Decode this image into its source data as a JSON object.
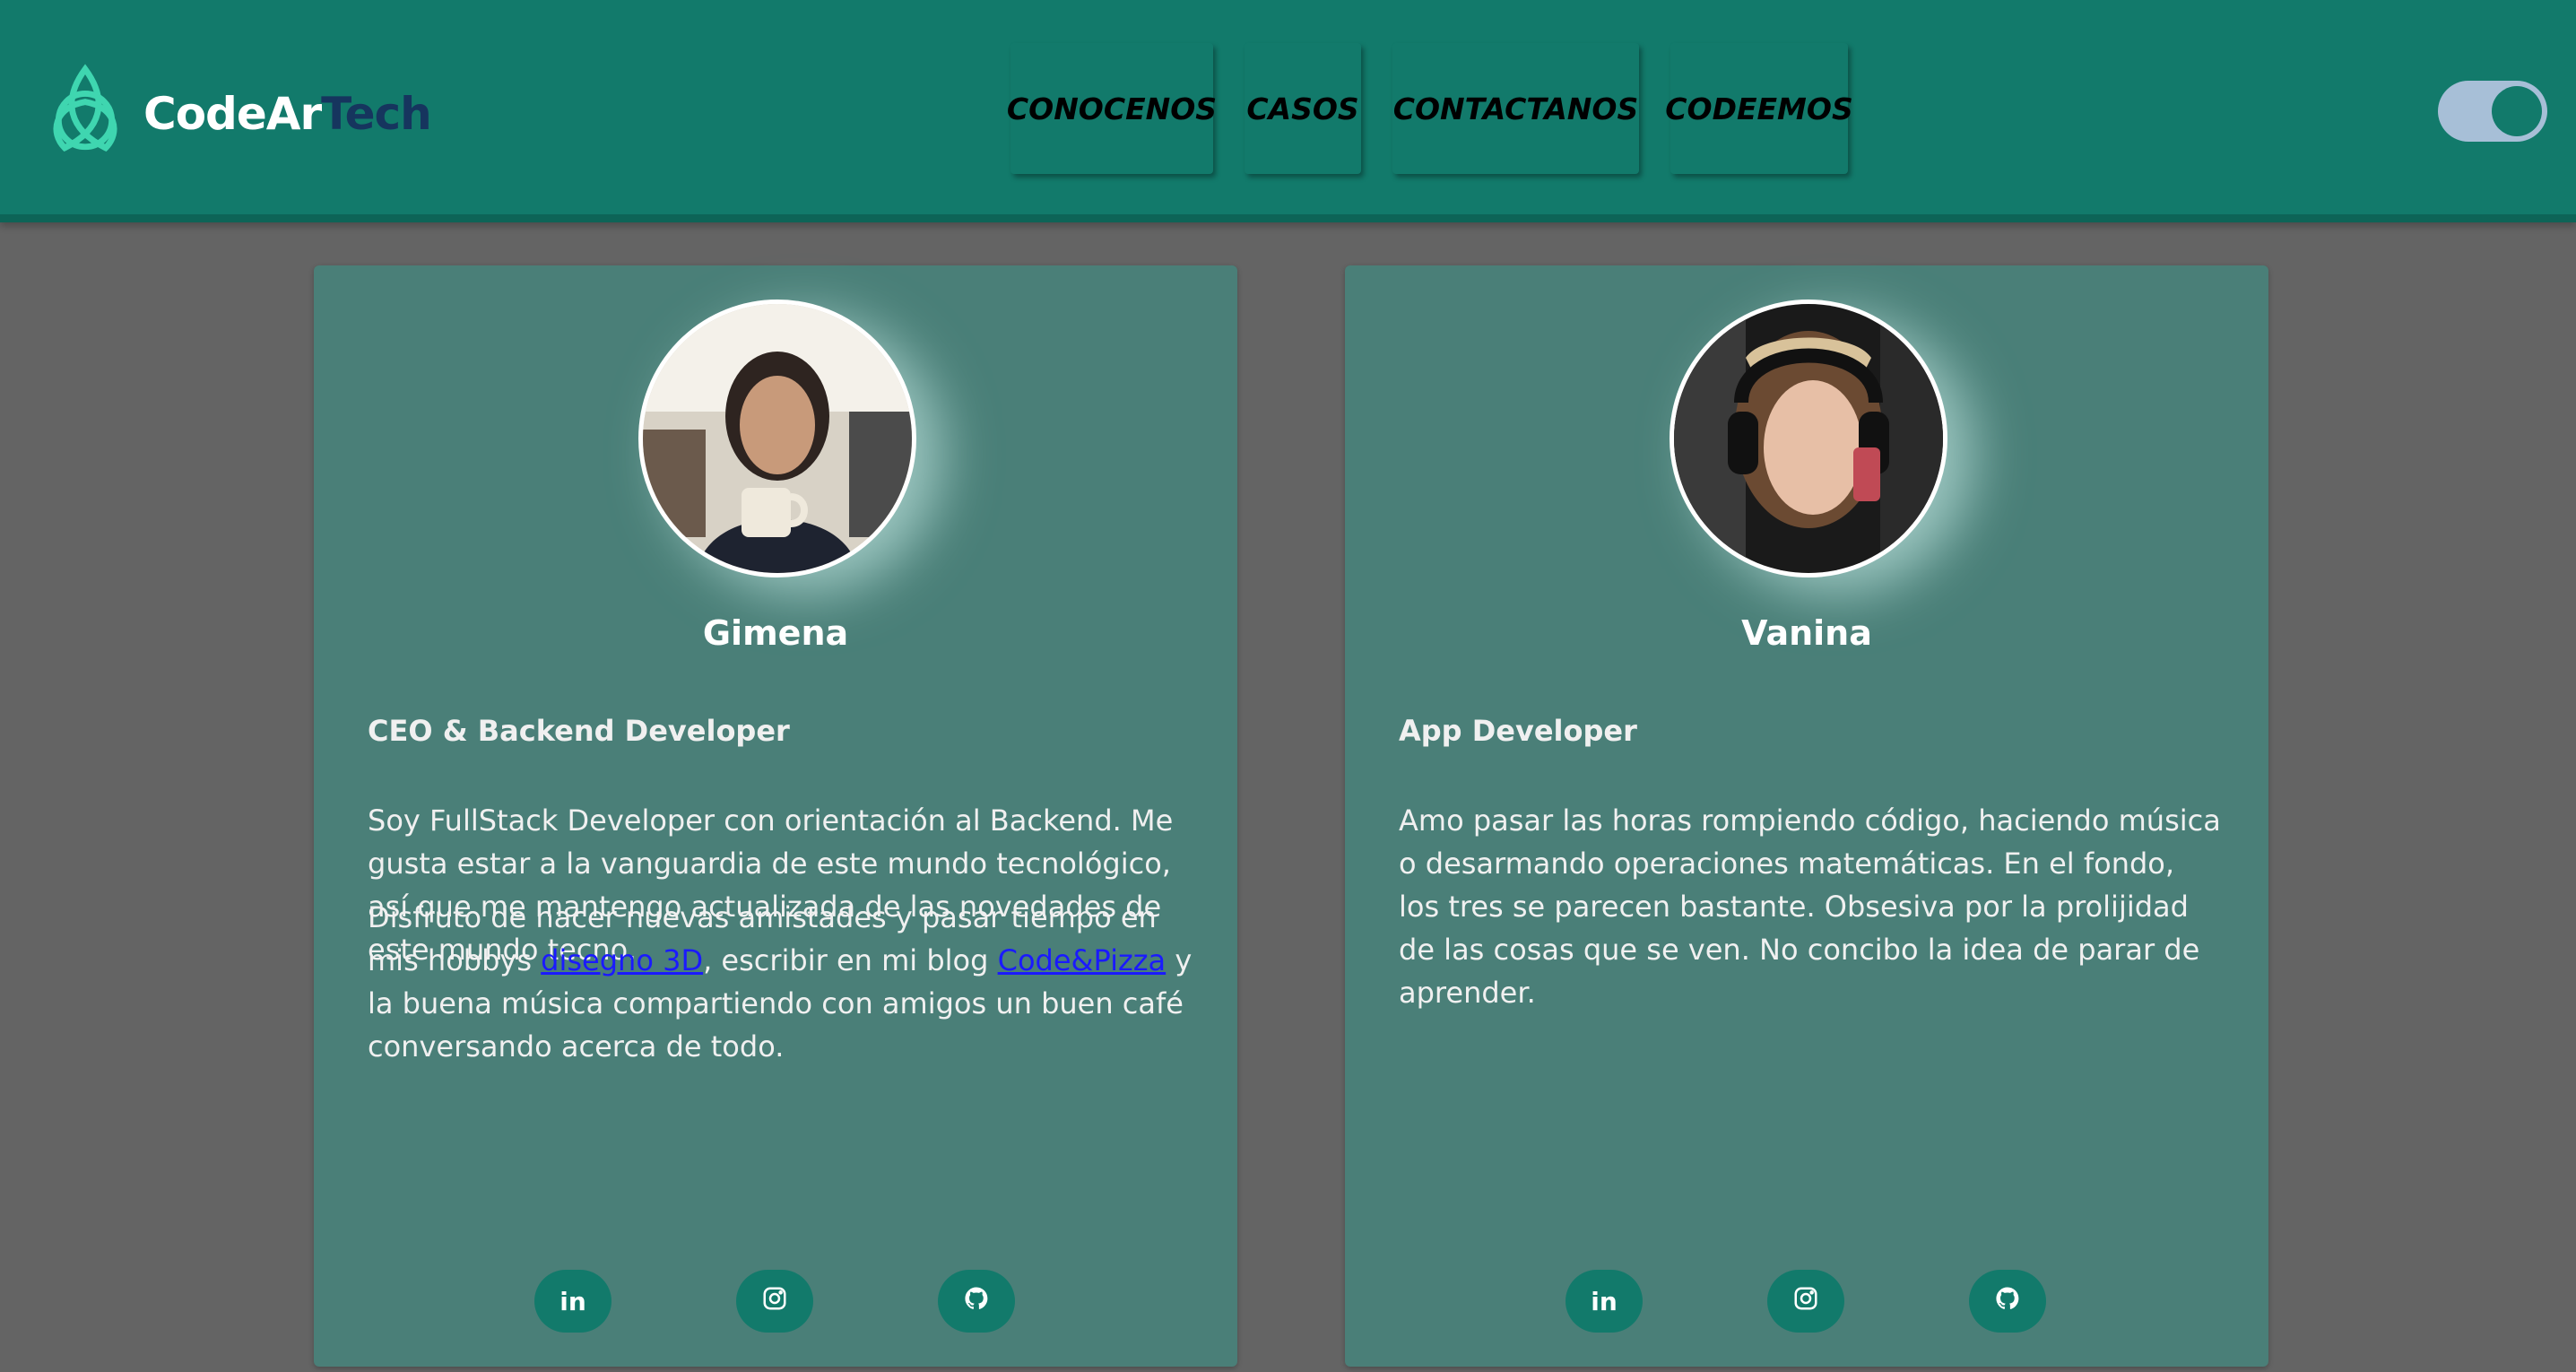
{
  "header": {
    "brand_part1": "CodeAr",
    "brand_part2": "Tech",
    "logo_icon": "triquetra-logo-icon",
    "nav": [
      "CONOCENOS",
      "CASOS",
      "CONTACTANOS",
      "CODEEMOS"
    ],
    "theme_toggle": {
      "state": "on"
    }
  },
  "colors": {
    "background": "#646464",
    "header": "#127a6b",
    "card": "#4a7f78",
    "brand_accent": "#16355e",
    "logo": "#3fd6b0",
    "link": "#1a1aff"
  },
  "cards": [
    {
      "name": "Gimena",
      "role": "CEO & Backend Developer",
      "bio1": "Soy FullStack Developer con orientación al Backend. Me gusta estar a la vanguardia de este mundo tecnológico, así que me mantengo actualizada de las novedades de este mundo tecno.",
      "bio2_part1": "Disfruto de hacer nuevas amistades y pasar tiempo en mis hobbys ",
      "bio2_link1": "disegno 3D",
      "bio2_part2": ", escribir en mi blog ",
      "bio2_link2": "Code&Pizza",
      "bio2_part3": " y la buena música compartiendo con amigos un buen café conversando acerca de todo.",
      "social": {
        "linkedin": "in",
        "instagram": "instagram-icon",
        "github": "github-icon"
      }
    },
    {
      "name": "Vanina",
      "role": "App Developer",
      "bio1": "Amo pasar las horas rompiendo código, haciendo música o desarmando operaciones matemáticas. En el fondo, los tres se parecen bastante. Obsesiva por la prolijidad de las cosas que se ven. No concibo la idea de parar de aprender.",
      "social": {
        "linkedin": "in",
        "instagram": "instagram-icon",
        "github": "github-icon"
      }
    }
  ]
}
